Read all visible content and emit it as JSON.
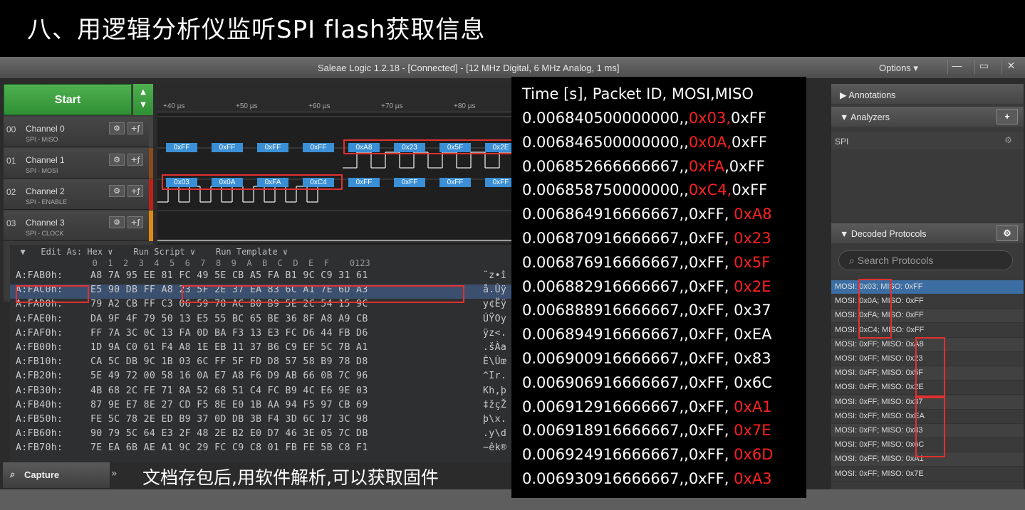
{
  "slide_title": "八、用逻辑分析仪监听SPI  flash获取信息",
  "window": {
    "title": "Saleae Logic 1.2.18 - [Connected] - [12 MHz Digital, 6 MHz Analog, 1 ms]",
    "options": "Options ▾",
    "minimize": "—",
    "maximize": "▭",
    "close": "✕"
  },
  "start_label": "Start",
  "channels": [
    {
      "num": "00",
      "name": "Channel 0",
      "sub": "SPI - MISO",
      "color": "#444"
    },
    {
      "num": "01",
      "name": "Channel 1",
      "sub": "SPI - MOSI",
      "color": "#8a4a1a"
    },
    {
      "num": "02",
      "name": "Channel 2",
      "sub": "SPI - ENABLE",
      "color": "#c0201a"
    },
    {
      "num": "03",
      "name": "Channel 3",
      "sub": "SPI - CLOCK",
      "color": "#e08a10"
    }
  ],
  "ruler_ticks": [
    "+40 µs",
    "+50 µs",
    "+60 µs",
    "+70 µs",
    "+80 µs"
  ],
  "miso_packets": [
    "0xFF",
    "0xFF",
    "0xFF",
    "0xFF",
    "0xA8",
    "0x23",
    "0x5F",
    "0x2E"
  ],
  "mosi_packets": [
    "0x03",
    "0x0A",
    "0xFA",
    "0xC4",
    "0xFF",
    "0xFF",
    "0xFF",
    "0xFF"
  ],
  "hex": {
    "header": "  ▼   Edit As: Hex ∨    Run Script ∨    Run Template ∨",
    "columns": "                0  1  2  3  4  5  6  7  8  9  A  B  C  D  E  F    0123",
    "rows": [
      {
        "addr": "A:FAB0h:",
        "bytes": "A8 7A 95 EE 81 FC 49 5E CB A5 FA B1 9C C9 31 61",
        "ascii": "¨z•î"
      },
      {
        "addr": "A:FAC0h:",
        "bytes": "E5 90 DB FF A8 23 5F 2E 37 EA 83 6C A1 7E 6D A3",
        "ascii": "å.Ûÿ"
      },
      {
        "addr": "A:FAD0h:",
        "bytes": "79 A2 CB FF C3 06 59 78 AC B0 B9 5E 2C 54 15 9C",
        "ascii": "y¢Ëÿ"
      },
      {
        "addr": "A:FAE0h:",
        "bytes": "DA 9F 4F 79 50 13 E5 55 BC 65 BE 36 8F A8 A9 CB",
        "ascii": "ÚŸOy"
      },
      {
        "addr": "A:FAF0h:",
        "bytes": "FF 7A 3C 0C 13 FA 0D BA F3 13 E3 FC D6 44 FB D6",
        "ascii": "ÿz<."
      },
      {
        "addr": "A:FB00h:",
        "bytes": "1D 9A C0 61 F4 A8 1E EB 11 37 B6 C9 EF 5C 7B A1",
        "ascii": ".šÀa"
      },
      {
        "addr": "A:FB10h:",
        "bytes": "CA 5C DB 9C 1B 03 6C FF 5F FD D8 57 58 B9 78 D8",
        "ascii": "Ê\\Ûœ"
      },
      {
        "addr": "A:FB20h:",
        "bytes": "5E 49 72 00 58 16 0A E7 A8 F6 D9 AB 66 0B 7C 96",
        "ascii": "^Ir."
      },
      {
        "addr": "A:FB30h:",
        "bytes": "4B 68 2C FE 71 8A 52 68 51 C4 FC B9 4C E6 9E 03",
        "ascii": "Kh,þ"
      },
      {
        "addr": "A:FB40h:",
        "bytes": "87 9E E7 8E 27 CD F5 8E E0 1B AA 94 F5 97 CB 69",
        "ascii": "‡žçŽ"
      },
      {
        "addr": "A:FB50h:",
        "bytes": "FE 5C 78 2E ED B9 37 0D DB 3B F4 3D 6C 17 3C 98",
        "ascii": "þ\\x."
      },
      {
        "addr": "A:FB60h:",
        "bytes": "90 79 5C 64 E3 2F 48 2E B2 E0 D7 46 3E 05 7C DB",
        "ascii": ".y\\d"
      },
      {
        "addr": "A:FB70h:",
        "bytes": "7E EA 6B AE A1 9C 29 FC C9 C8 01 FB FE 5B C8 F1",
        "ascii": "~êk®"
      }
    ]
  },
  "capture_tab": "Capture",
  "capture_note": "文档存包后,用软件解析,可以获取固件",
  "right": {
    "annotations": "Annotations",
    "analyzers": "Analyzers",
    "analyzer_add": "+",
    "spi": "SPI",
    "decoded": "Decoded Protocols",
    "search_placeholder": "Search Protocols",
    "decoded_rows": [
      "MOSI: 0x03;  MISO: 0xFF",
      "MOSI: 0x0A;  MISO: 0xFF",
      "MOSI: 0xFA;  MISO: 0xFF",
      "MOSI: 0xC4;  MISO: 0xFF",
      "MOSI: 0xFF;  MISO: 0xA8",
      "MOSI: 0xFF;  MISO: 0x23",
      "MOSI: 0xFF;  MISO: 0x5F",
      "MOSI: 0xFF;  MISO: 0x2E",
      "MOSI: 0xFF;  MISO: 0x37",
      "MOSI: 0xFF;  MISO: 0xEA",
      "MOSI: 0xFF;  MISO: 0x83",
      "MOSI: 0xFF;  MISO: 0x6C",
      "MOSI: 0xFF;  MISO: 0xA1",
      "MOSI: 0xFF;  MISO: 0x7E"
    ]
  },
  "overlay": {
    "header": "Time [s], Packet ID, MOSI,MISO",
    "rows": [
      {
        "time": "0.006840500000000,,",
        "mosi": "0x03,",
        "miso": "0xFF",
        "red": "mosi"
      },
      {
        "time": "0.006846500000000,,",
        "mosi": "0x0A,",
        "miso": "0xFF",
        "red": "mosi"
      },
      {
        "time": "0.006852666666667,,",
        "mosi": "0xFA",
        "miso": ",0xFF",
        "red": "mosi"
      },
      {
        "time": "0.006858750000000,,",
        "mosi": "0xC4,",
        "miso": "0xFF",
        "red": "mosi"
      },
      {
        "time": "0.006864916666667,,",
        "mosi": "0xFF, ",
        "miso": "0xA8",
        "red": "miso"
      },
      {
        "time": "0.006870916666667,,",
        "mosi": "0xFF, ",
        "miso": "0x23",
        "red": "miso"
      },
      {
        "time": "0.006876916666667,,",
        "mosi": "0xFF, ",
        "miso": "0x5F",
        "red": "miso"
      },
      {
        "time": "0.006882916666667,,",
        "mosi": "0xFF, ",
        "miso": "0x2E",
        "red": "miso"
      },
      {
        "time": "0.006888916666667,,",
        "mosi": "0xFF, ",
        "miso": "0x37",
        "red": "none"
      },
      {
        "time": "0.006894916666667,,",
        "mosi": "0xFF, ",
        "miso": "0xEA",
        "red": "none"
      },
      {
        "time": "0.006900916666667,,",
        "mosi": "0xFF, ",
        "miso": "0x83",
        "red": "none"
      },
      {
        "time": "0.006906916666667,,",
        "mosi": "0xFF, ",
        "miso": "0x6C",
        "red": "none"
      },
      {
        "time": "0.006912916666667,,",
        "mosi": "0xFF, ",
        "miso": "0xA1",
        "red": "miso"
      },
      {
        "time": "0.006918916666667,,",
        "mosi": "0xFF, ",
        "miso": "0x7E",
        "red": "miso"
      },
      {
        "time": "0.006924916666667,,",
        "mosi": "0xFF, ",
        "miso": "0x6D",
        "red": "miso"
      },
      {
        "time": "0.006930916666667,,",
        "mosi": "0xFF, ",
        "miso": "0xA3",
        "red": "miso"
      }
    ]
  },
  "colors": {
    "highlight": "#e23030",
    "packet": "#3a8fd6",
    "start_green": "#3fa043"
  }
}
